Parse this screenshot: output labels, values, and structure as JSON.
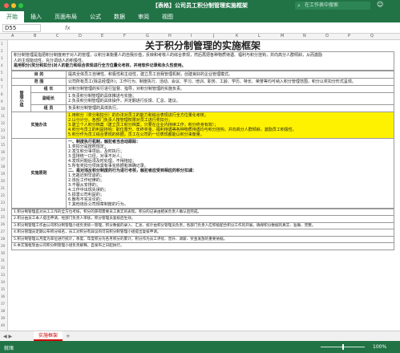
{
  "window": {
    "title": "【表格】公司员工积分制管理实施框架",
    "search_placeholder": "在工作表中搜索",
    "colors": {
      "accent": "#217346",
      "highlight": "#fff200",
      "sheet_tab": "#c00000"
    }
  },
  "ribbon": {
    "tabs": [
      "开始",
      "插入",
      "页面布局",
      "公式",
      "数据",
      "审阅",
      "视图"
    ]
  },
  "formula_bar": {
    "name_box": "D55",
    "fx": "fx"
  },
  "columns": [
    "A",
    "B",
    "C",
    "D",
    "E",
    "F",
    "G",
    "H",
    "I",
    "J",
    "K",
    "L",
    "M",
    "N",
    "O",
    "P",
    "Q"
  ],
  "rows": [
    "1",
    "2",
    "3",
    "4",
    "5",
    "6",
    "7",
    "8",
    "9",
    "10",
    "11",
    "12",
    "13",
    "14",
    "15",
    "16",
    "17",
    "18",
    "19",
    "20",
    "21",
    "22",
    "23",
    "24",
    "25",
    "26",
    "27",
    "28",
    "29",
    "30",
    "31",
    "32",
    "33",
    "34",
    "35",
    "36",
    "37",
    "38",
    "39",
    "40"
  ],
  "document": {
    "title": "关于积分制管理的实施框架",
    "intro": [
      "积分制管理是指把积分制度用于对人的管理，以积分来衡量人的自我价值，反映和考核人的综合表现，然后再把各种物质待遇、福利与积分挂钩，并向高分人群倾斜，从而激励",
      "人的主观能动性，充分调动人的积极性。",
      "是用积分(奖分和扣分)对人的能力和综合表现进行全方位量化考核，并用软件记录和永久性使用。"
    ],
    "rows": [
      {
        "label": "目 的",
        "text": "提高全体员工自律性、积极性和主动性，建立员工自我管理机制，创建良好的企业管理模式。"
      },
      {
        "label": "范 围",
        "text": "公司所有员工(除总经理外)；工作行为、制度执行、活动、会议、学习、培训、职务、工龄、学历、特长、荣誉等均可纳入积分管理范围，积分以奖扣分形式呈现。"
      },
      {
        "label": "组 长",
        "text": "对积分制管理的实行进行监督、指导，对积分制管理的实施负责。"
      },
      {
        "label": "副组长",
        "text": "1.负责积分制管理的具体推进与实施；\n2.负责积分制管理的具体操作，并定期进行反馈、汇总、建议。"
      },
      {
        "label": "组 员",
        "text": "负责积分制管理的具体执行。"
      }
    ],
    "management_label": "管理小组",
    "yellow_label": "实施办法",
    "yellow_lines": [
      "1.用积分（奖分和扣分）的办法对员工的能力和综合表现进行全方位量化考核；",
      "2.以分计分，各部门负责人按管理权限对员工进行奖扣分；",
      "3.建立个人积分档案（建立员工积分档案，只要在企业内持续工作，积分终身有效）；",
      "4.积分与员工的利益挂钩：职位晋升、年终奖金、福利待遇等各种物质待遇均与积分挂钩，并向高分人群倾斜，激励员工积极性。",
      "5.积分作为员工综合表现的依据，员工在公司的一切表现都能以积分来衡量。"
    ],
    "principle_label": "实施原则",
    "principle_lines": [
      "一、制度执行机制，触犯者当自动跟踪：",
      "1.奖扣分是按照规定；",
      "2.发生积分事项后，及时执行；",
      "3.坚持统一口径，对事不对人；",
      "4.发现问题后须及时处理，不得拖延；",
      "5.所有奖扣分项目需有事实依据和准确记录。",
      "二、是对违反积分制度的行为进行考核，触犯者应受到相应的积分扣减：",
      "1.无故迟到早退的；",
      "2.违反工作纪律的；",
      "3.不服从安排的；",
      "4.工作中出现失误的；",
      "5.损害公司利益的；",
      "6.散布不实言论的；",
      "7.其他违反公司规章制度的行为。"
    ],
    "bottom_lines": [
      "1.积分制管理是对员工工作的全方位考核，积分的获得需要员工真实的表现。积分的记录由相关负责人确认后完成。",
      "2.积分由员工本人提出申请，经部门负责人审核，积分管理员复核后生效。",
      "3.积分制管理工作由公司积分制管理小组负责统一管理，积分数据的录入、汇总、统计由积分管理员负责，各部门负责人应积极配合积分工作的开展，确保积分数据的真实、准确、完整。",
      "4.积分管理员定期公布积分排名，员工对积分有异议的可向积分制管理小组提出复核申请。",
      "5.积分制管理以月度为单位进行统计，季度、年度积分为各月积分的累计，积分作为员工评优、晋升、调薪、奖金发放的重要依据。",
      "6.本实施框架由公司积分制管理小组负责解释，自发布之日起执行。"
    ]
  },
  "sheet_tabs": [
    "实施框架"
  ],
  "status": {
    "ready": "就绪",
    "zoom": "100%"
  }
}
